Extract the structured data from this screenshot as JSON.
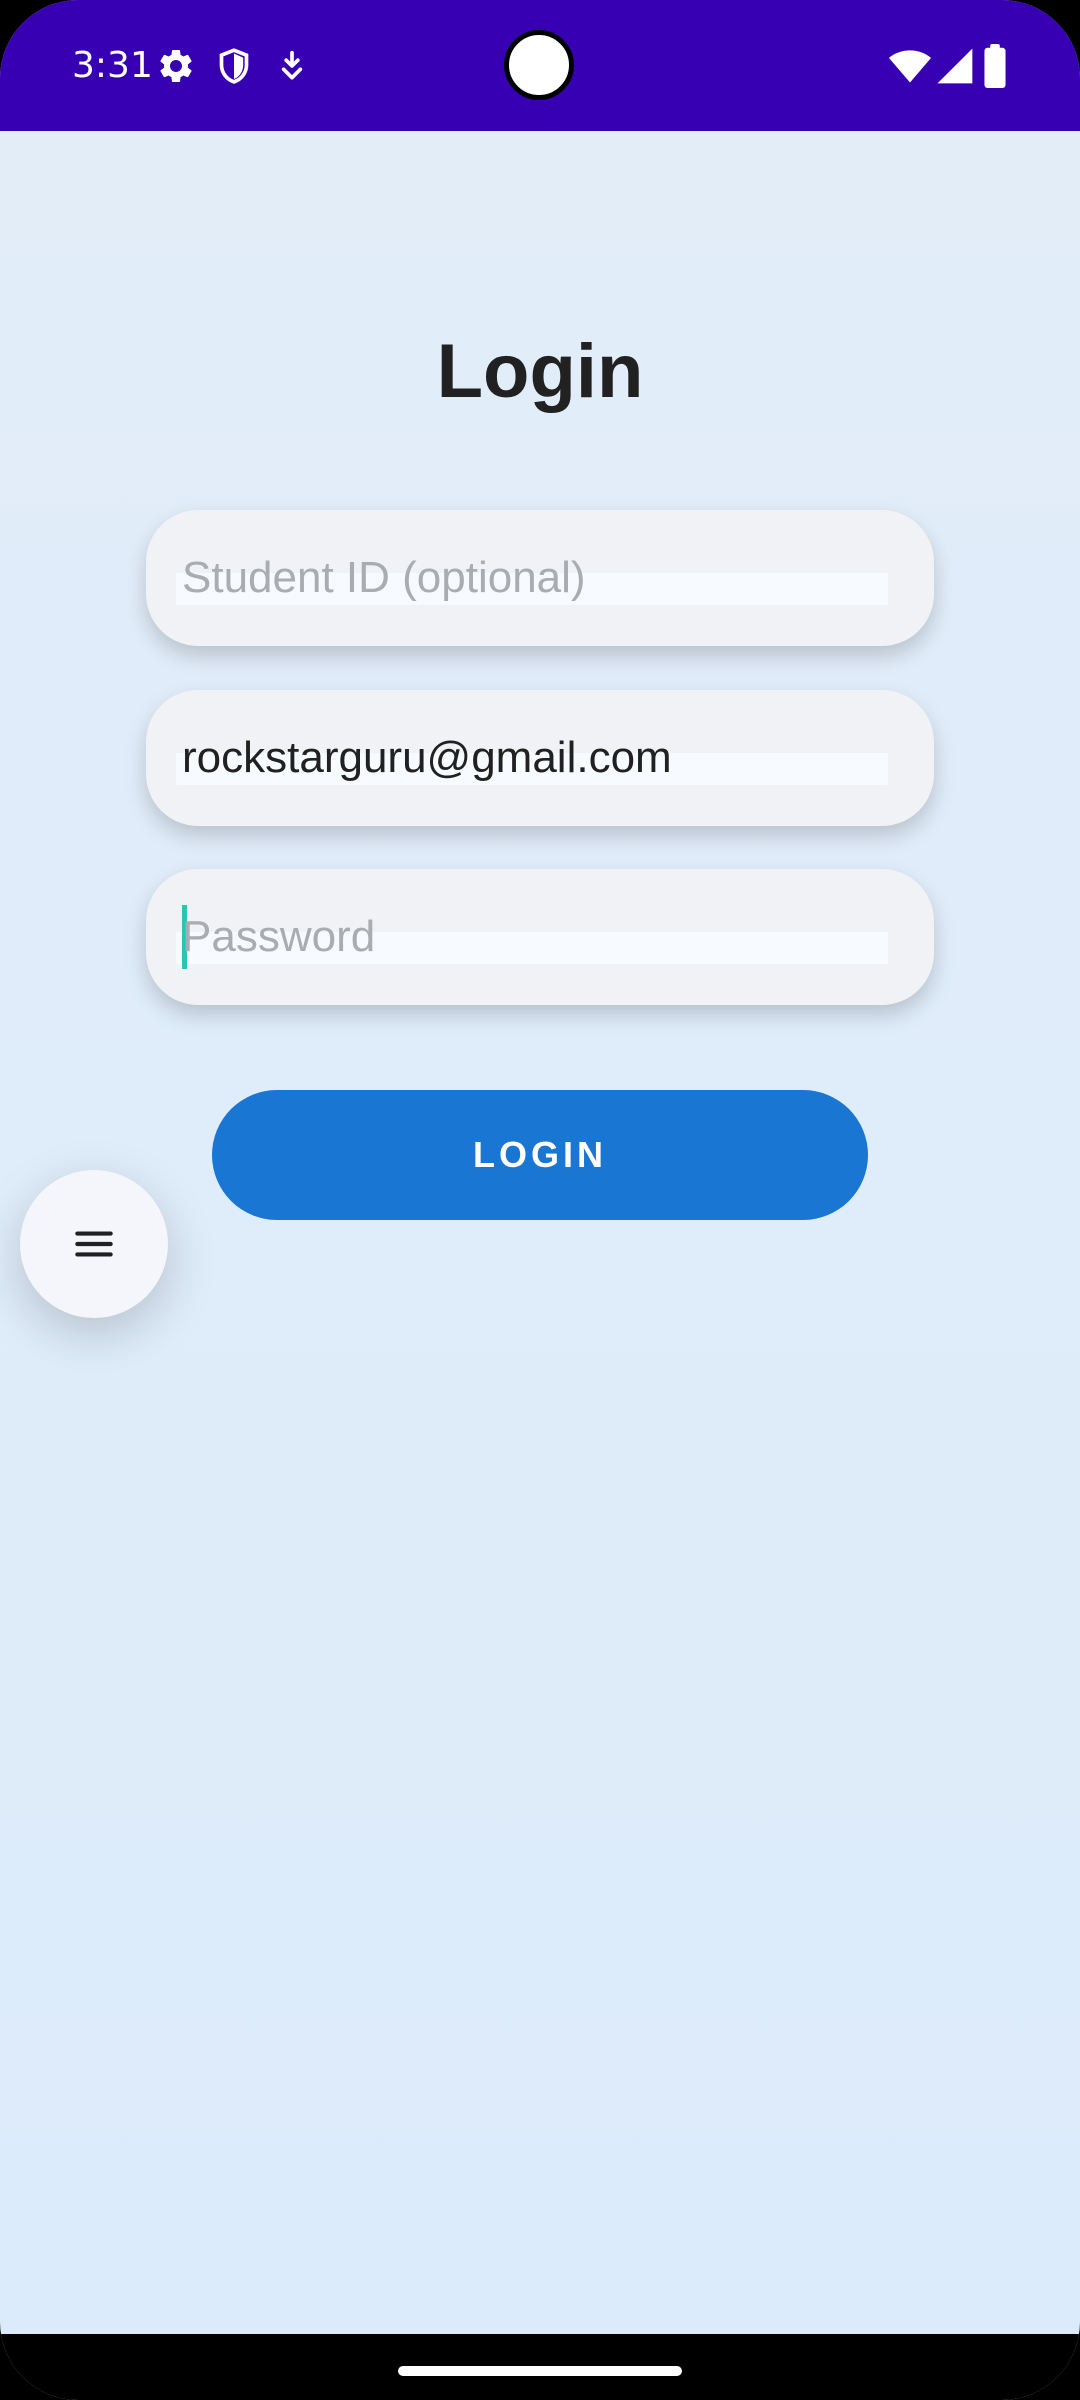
{
  "status_bar": {
    "time": "3:31",
    "background_color": "#3700b3",
    "left_icons": [
      "settings-gear-icon",
      "shield-icon",
      "download-icon"
    ],
    "right_icons": [
      "wifi-icon",
      "cellular-signal-icon",
      "battery-icon"
    ]
  },
  "page": {
    "title": "Login",
    "background_color": "#dfecfa"
  },
  "form": {
    "student_id": {
      "value": "",
      "placeholder": "Student ID (optional)"
    },
    "email": {
      "value": "rockstarguru@gmail.com",
      "placeholder": ""
    },
    "password": {
      "value": "",
      "placeholder": "Password",
      "focused": true
    },
    "login_button_label": "LOGIN",
    "login_button_color": "#1976d2"
  },
  "fab": {
    "icon": "menu-icon"
  }
}
